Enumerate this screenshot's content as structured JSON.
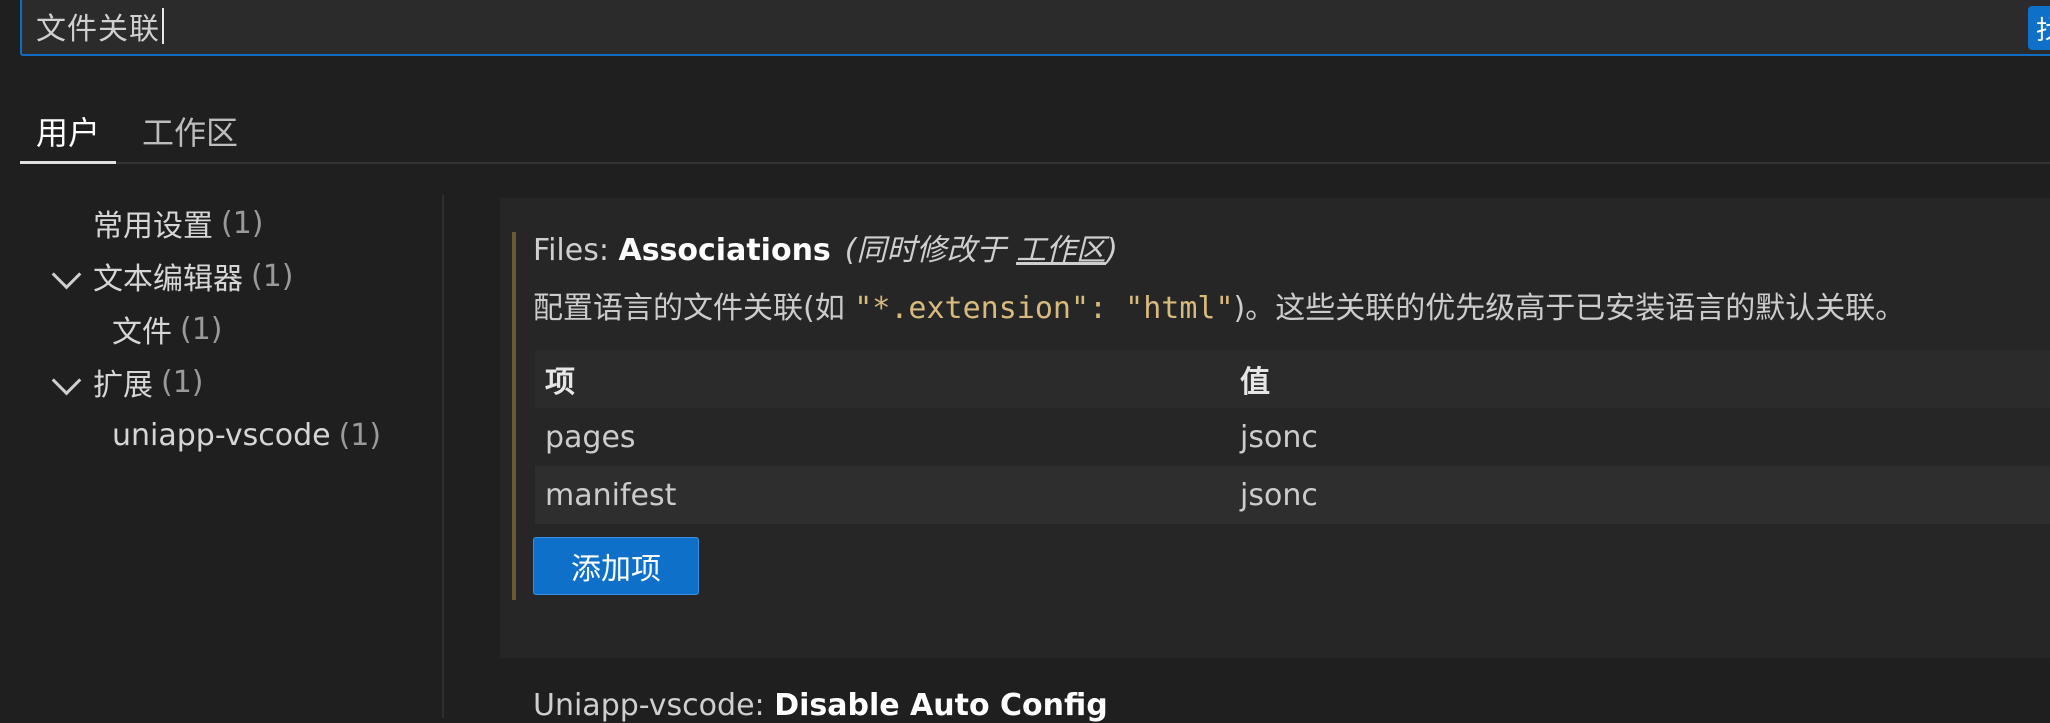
{
  "search": {
    "value": "文件关联",
    "action_glyph": "找"
  },
  "tabs": [
    {
      "label": "用户",
      "active": true
    },
    {
      "label": "工作区",
      "active": false
    }
  ],
  "toc": {
    "items": [
      {
        "label": "常用设置",
        "count": "(1)"
      },
      {
        "label": "文本编辑器",
        "count": "(1)",
        "expanded": true
      },
      {
        "label": "文件",
        "count": "(1)"
      },
      {
        "label": "扩展",
        "count": "(1)",
        "expanded": true
      },
      {
        "label": "uniapp-vscode",
        "count": "(1)"
      }
    ]
  },
  "setting": {
    "category": "Files:",
    "name": "Associations",
    "note_prefix": "(同时修改于",
    "note_link": "工作区",
    "note_suffix": ")",
    "desc_before": "配置语言的文件关联(如 ",
    "desc_code": "\"*.extension\": \"html\"",
    "desc_after": ")。这些关联的优先级高于已安装语言的默认关联。",
    "table": {
      "headers": {
        "key": "项",
        "value": "值"
      },
      "rows": [
        {
          "key": "pages",
          "value": "jsonc"
        },
        {
          "key": "manifest",
          "value": "jsonc"
        }
      ]
    },
    "add_button": "添加项"
  },
  "next_setting": {
    "category": "Uniapp-vscode:",
    "name": "Disable Auto Config"
  },
  "colors": {
    "accent": "#0e70c8",
    "background": "#1f1f1f",
    "code": "#d7ba7d",
    "modified_bar": "#6b5a2f"
  }
}
